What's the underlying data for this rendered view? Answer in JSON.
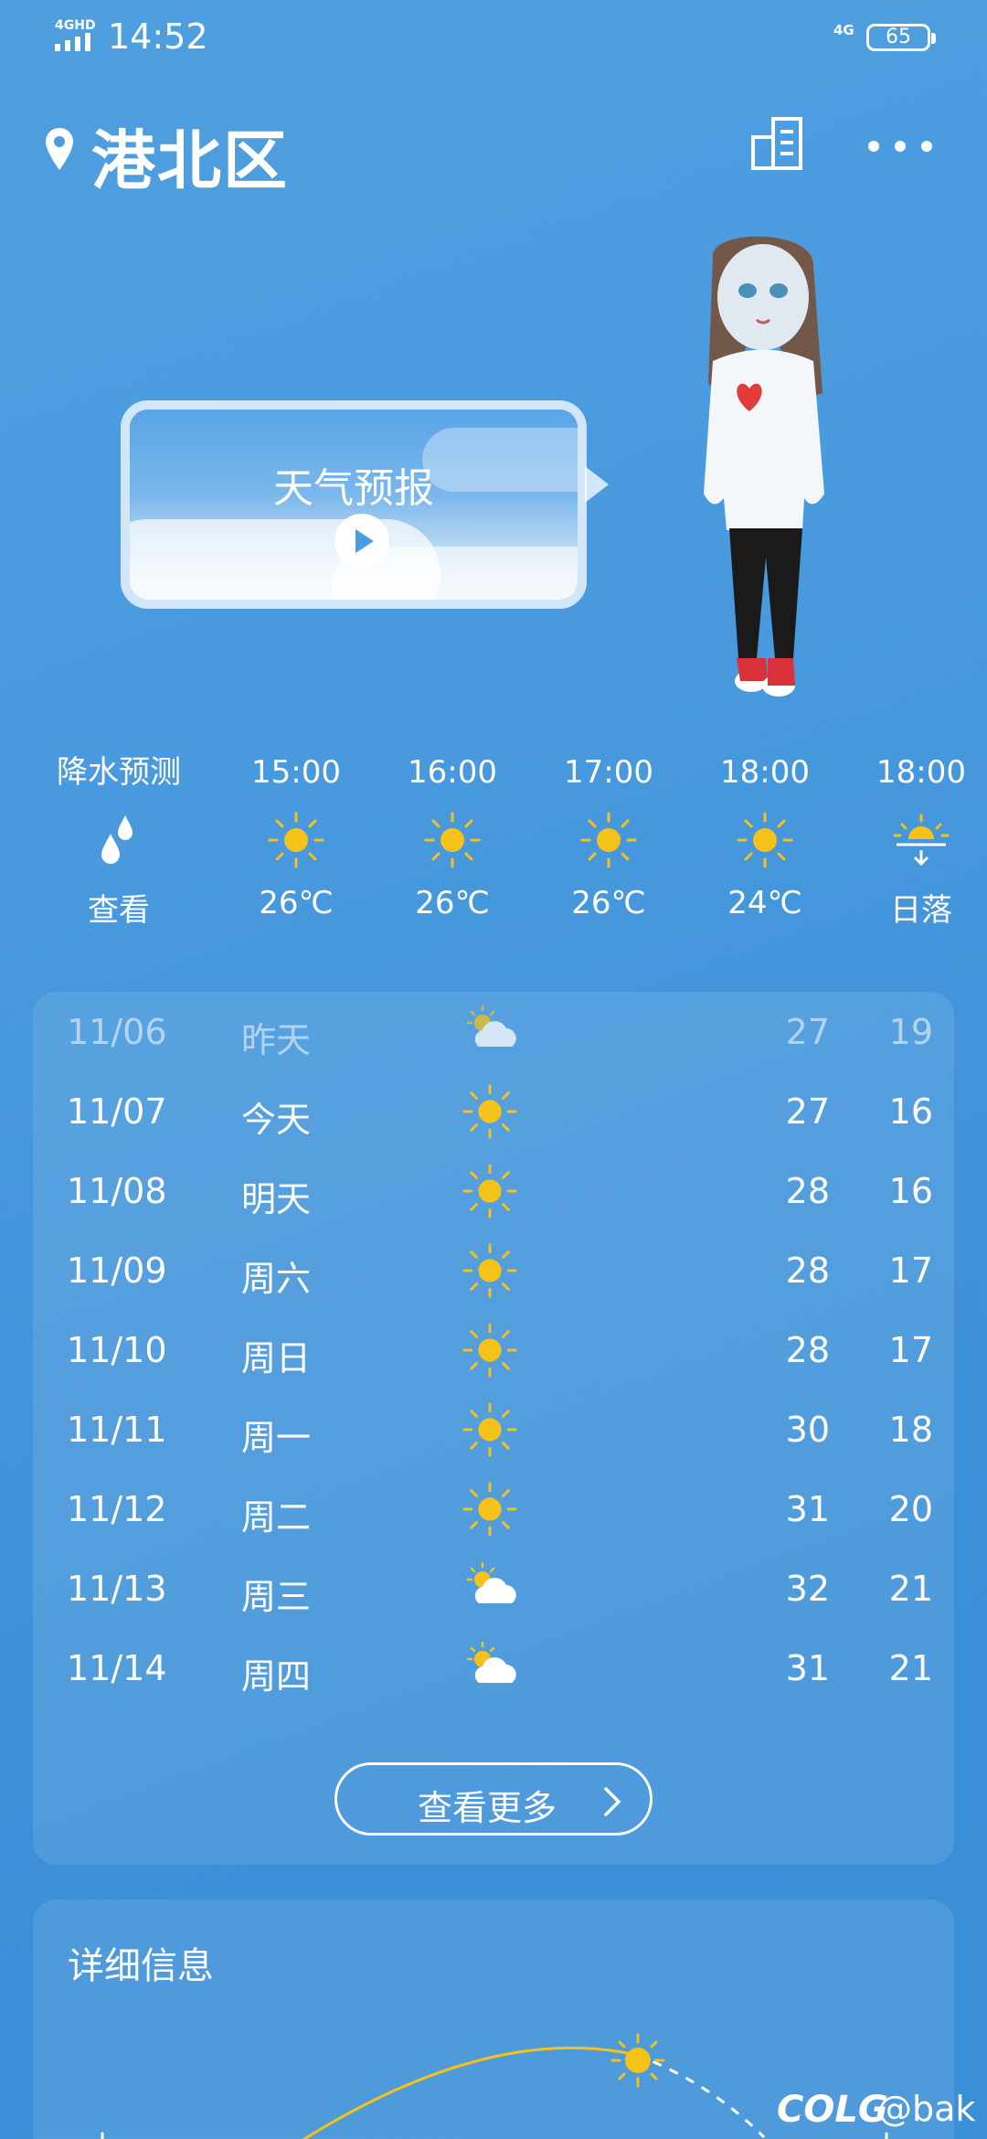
{
  "status_bar": {
    "network_left": "4GHD",
    "time": "14:52",
    "network_right": "4G",
    "battery": "65"
  },
  "header": {
    "location": "港北区",
    "location_icon": "location-pin-icon",
    "city_list_icon": "buildings-icon",
    "more_icon": "more-dots-icon"
  },
  "video_card": {
    "title": "天气预报",
    "play_icon": "play-icon"
  },
  "hourly": [
    {
      "label": "降水预测",
      "icon": "raindrops-icon",
      "value": "查看"
    },
    {
      "label": "15:00",
      "icon": "sun-icon",
      "value": "26℃"
    },
    {
      "label": "16:00",
      "icon": "sun-icon",
      "value": "26℃"
    },
    {
      "label": "17:00",
      "icon": "sun-icon",
      "value": "26℃"
    },
    {
      "label": "18:00",
      "icon": "sun-icon",
      "value": "24℃"
    },
    {
      "label": "18:00",
      "icon": "sunset-icon",
      "value": "日落"
    }
  ],
  "daily": [
    {
      "date": "11/06",
      "day": "昨天",
      "icon": "partly-cloudy-icon",
      "high": "27",
      "low": "19"
    },
    {
      "date": "11/07",
      "day": "今天",
      "icon": "sun-icon",
      "high": "27",
      "low": "16"
    },
    {
      "date": "11/08",
      "day": "明天",
      "icon": "sun-icon",
      "high": "28",
      "low": "16"
    },
    {
      "date": "11/09",
      "day": "周六",
      "icon": "sun-icon",
      "high": "28",
      "low": "17"
    },
    {
      "date": "11/10",
      "day": "周日",
      "icon": "sun-icon",
      "high": "28",
      "low": "17"
    },
    {
      "date": "11/11",
      "day": "周一",
      "icon": "sun-icon",
      "high": "30",
      "low": "18"
    },
    {
      "date": "11/12",
      "day": "周二",
      "icon": "sun-icon",
      "high": "31",
      "low": "20"
    },
    {
      "date": "11/13",
      "day": "周三",
      "icon": "partly-cloudy-icon",
      "high": "32",
      "low": "21"
    },
    {
      "date": "11/14",
      "day": "周四",
      "icon": "partly-cloudy-icon",
      "high": "31",
      "low": "21"
    }
  ],
  "more_button": "查看更多",
  "detail": {
    "title": "详细信息"
  },
  "watermark": {
    "brand": "COLG",
    "user": "@bak"
  },
  "colors": {
    "sun": "#f5c21a",
    "background": "#4395db",
    "card": "rgba(255,255,255,0.10)"
  }
}
